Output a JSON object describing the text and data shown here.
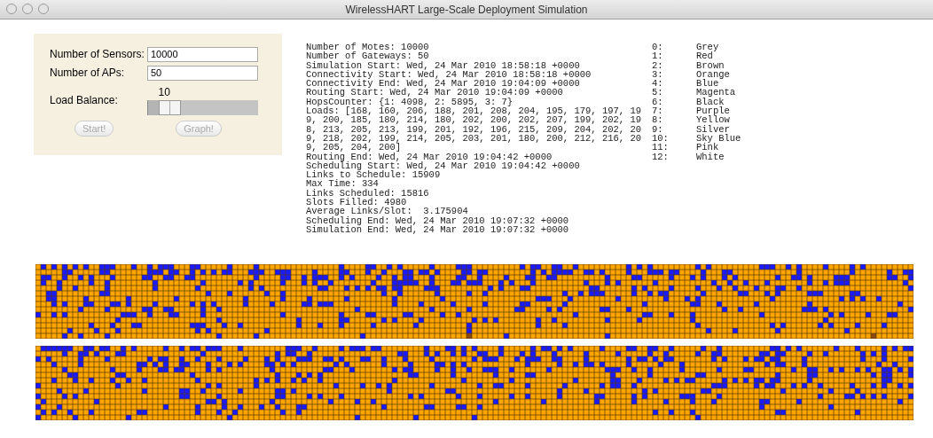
{
  "window": {
    "title": "WirelessHART Large-Scale Deployment Simulation"
  },
  "form": {
    "fields": [
      {
        "label": "Number of Sensors:",
        "value": "10000"
      },
      {
        "label": "Number of APs:",
        "value": "50"
      }
    ],
    "slider": {
      "label": "Load Balance:",
      "reading": "10",
      "level": 0.1
    },
    "buttons": [
      {
        "label": "Start!",
        "disabled": true
      },
      {
        "label": "Graph!",
        "disabled": true
      }
    ]
  },
  "log": [
    "Number of Motes: 10000",
    "Number of Gateways: 50",
    "Simulation Start: Wed, 24 Mar 2010 18:58:18 +0000",
    "Connectivity Start: Wed, 24 Mar 2010 18:58:18 +0000",
    "Connectivity End: Wed, 24 Mar 2010 19:04:09 +0000",
    "Routing Start: Wed, 24 Mar 2010 19:04:09 +0000",
    "HopsCounter: {1: 4098, 2: 5895, 3: 7}",
    "Loads: [168, 160, 206, 188, 201, 208, 204, 195, 179, 197, 19",
    "9, 200, 185, 180, 214, 180, 202, 200, 202, 207, 199, 202, 19",
    "8, 213, 205, 213, 199, 201, 192, 196, 215, 209, 204, 202, 20",
    "9, 218, 202, 199, 214, 205, 203, 201, 180, 200, 212, 216, 20",
    "9, 205, 204, 200]",
    "Routing End: Wed, 24 Mar 2010 19:04:42 +0000",
    "Scheduling Start: Wed, 24 Mar 2010 19:04:42 +0000",
    "Links to Schedule: 15909",
    "Max Time: 334",
    "Links Scheduled: 15816",
    "Slots Filled: 4980",
    "Average Links/Slot:  3.175904",
    "Scheduling End: Wed, 24 Mar 2010 19:07:32 +0000",
    "Simulation End: Wed, 24 Mar 2010 19:07:32 +0000"
  ],
  "legend": [
    {
      "index": "0:",
      "name": "Grey"
    },
    {
      "index": "1:",
      "name": "Red"
    },
    {
      "index": "2:",
      "name": "Brown"
    },
    {
      "index": "3:",
      "name": "Orange"
    },
    {
      "index": "4:",
      "name": "Blue"
    },
    {
      "index": "5:",
      "name": "Magenta"
    },
    {
      "index": "6:",
      "name": "Black"
    },
    {
      "index": "7:",
      "name": "Purple"
    },
    {
      "index": "8:",
      "name": "Yellow"
    },
    {
      "index": "9:",
      "name": "Silver"
    },
    {
      "index": "10:",
      "name": "Sky Blue"
    },
    {
      "index": "11:",
      "name": "Pink"
    },
    {
      "index": "12:",
      "name": "White"
    }
  ]
}
